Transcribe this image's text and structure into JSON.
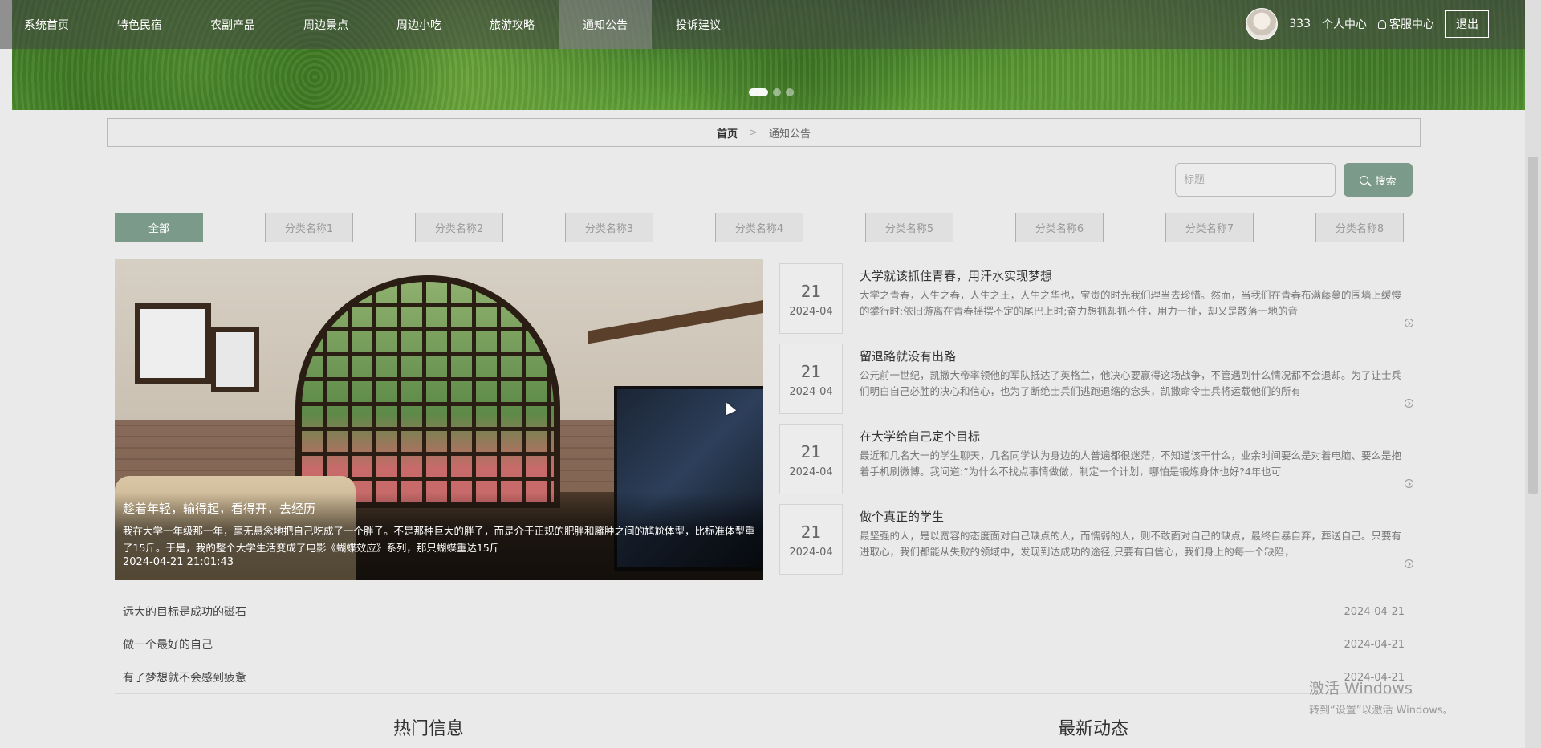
{
  "nav": {
    "items": [
      "系统首页",
      "特色民宿",
      "农副产品",
      "周边景点",
      "周边小吃",
      "旅游攻略",
      "通知公告",
      "投诉建议"
    ],
    "active_index": 6,
    "username": "333",
    "personal_center": "个人中心",
    "service_center": "客服中心",
    "logout": "退出"
  },
  "banner": {
    "dot_count": 3,
    "active_dot": 0
  },
  "breadcrumb": {
    "home": "首页",
    "separator": ">",
    "current": "通知公告"
  },
  "search": {
    "placeholder": "标题",
    "button": "搜索"
  },
  "categories": [
    "全部",
    "分类名称1",
    "分类名称2",
    "分类名称3",
    "分类名称4",
    "分类名称5",
    "分类名称6",
    "分类名称7",
    "分类名称8"
  ],
  "active_category": 0,
  "feature": {
    "title": "趁着年轻，输得起，看得开，去经历",
    "desc": "我在大学一年级那一年，毫无悬念地把自己吃成了一个胖子。不是那种巨大的胖子，而是介于正规的肥胖和臃肿之间的尴尬体型，比标准体型重了15斤。于是，我的整个大学生活变成了电影《蝴蝶效应》系列，那只蝴蝶重达15斤",
    "time": "2024-04-21 21:01:43"
  },
  "news": [
    {
      "day": "21",
      "ym": "2024-04",
      "title": "大学就该抓住青春，用汗水实现梦想",
      "desc": "大学之青春，人生之春，人生之王，人生之华也，宝贵的时光我们理当去珍惜。然而，当我们在青春布满藤蔓的围墙上缓慢的攀行时;依旧游离在青春摇摆不定的尾巴上时;奋力想抓却抓不住，用力一扯，却又是散落一地的音"
    },
    {
      "day": "21",
      "ym": "2024-04",
      "title": "留退路就没有出路",
      "desc": "公元前一世纪，凯撒大帝率领他的军队抵达了英格兰，他决心要赢得这场战争，不管遇到什么情况都不会退却。为了让士兵们明白自己必胜的决心和信心，也为了断绝士兵们逃跑退缩的念头，凯撒命令士兵将运载他们的所有"
    },
    {
      "day": "21",
      "ym": "2024-04",
      "title": "在大学给自己定个目标",
      "desc": "最近和几名大一的学生聊天，几名同学认为身边的人普遍都很迷茫，不知道该干什么，业余时间要么是对着电脑、要么是抱着手机刷微博。我问道:“为什么不找点事情做做，制定一个计划，哪怕是锻炼身体也好?4年也可"
    },
    {
      "day": "21",
      "ym": "2024-04",
      "title": "做个真正的学生",
      "desc": "最坚强的人，是以宽容的态度面对自己缺点的人，而懦弱的人，则不敢面对自己的缺点，最终自暴自弃，葬送自己。只要有进取心，我们都能从失败的领域中，发现到达成功的途径;只要有自信心，我们身上的每一个缺陷，"
    }
  ],
  "list": [
    {
      "title": "远大的目标是成功的磁石",
      "date": "2024-04-21"
    },
    {
      "title": "做一个最好的自己",
      "date": "2024-04-21"
    },
    {
      "title": "有了梦想就不会感到疲惫",
      "date": "2024-04-21"
    }
  ],
  "sections": {
    "hot": "热门信息",
    "latest": "最新动态"
  },
  "watermark": {
    "line1": "激活 Windows",
    "line2": "转到“设置”以激活 Windows。"
  },
  "colors": {
    "accent": "#7c9a8a",
    "nav_bg": "#464646"
  }
}
